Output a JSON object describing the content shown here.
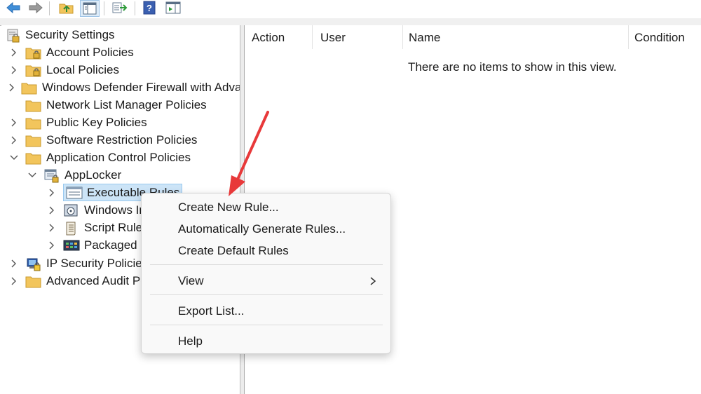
{
  "toolbar": {
    "buttons": [
      {
        "icon": "back-arrow-icon"
      },
      {
        "icon": "forward-arrow-icon"
      },
      {
        "icon": "up-folder-icon"
      },
      {
        "icon": "show-hide-tree-icon"
      },
      {
        "icon": "export-list-icon"
      },
      {
        "icon": "help-icon"
      },
      {
        "icon": "action-pane-icon"
      }
    ]
  },
  "tree": {
    "root": "Security Settings",
    "items": [
      {
        "label": "Account Policies"
      },
      {
        "label": "Local Policies"
      },
      {
        "label": "Windows Defender Firewall with Advai"
      },
      {
        "label": "Network List Manager Policies"
      },
      {
        "label": "Public Key Policies"
      },
      {
        "label": "Software Restriction Policies"
      },
      {
        "label": "Application Control Policies"
      },
      {
        "label": "AppLocker"
      },
      {
        "label": "Executable Rules"
      },
      {
        "label": "Windows Ir"
      },
      {
        "label": "Script Rules"
      },
      {
        "label": "Packaged a"
      },
      {
        "label": "IP Security Policies"
      },
      {
        "label": "Advanced Audit Po"
      }
    ]
  },
  "list": {
    "columns": [
      "Action",
      "User",
      "Name",
      "Condition"
    ],
    "empty_message": "There are no items to show in this view."
  },
  "context_menu": {
    "items": [
      {
        "label": "Create New Rule..."
      },
      {
        "label": "Automatically Generate Rules..."
      },
      {
        "label": "Create Default Rules"
      },
      {
        "label": "View"
      },
      {
        "label": "Export List..."
      },
      {
        "label": "Help"
      }
    ]
  },
  "colors": {
    "selection": "#cce4f7",
    "annotation_arrow": "#e8393a",
    "folder": "#f2c55c"
  }
}
